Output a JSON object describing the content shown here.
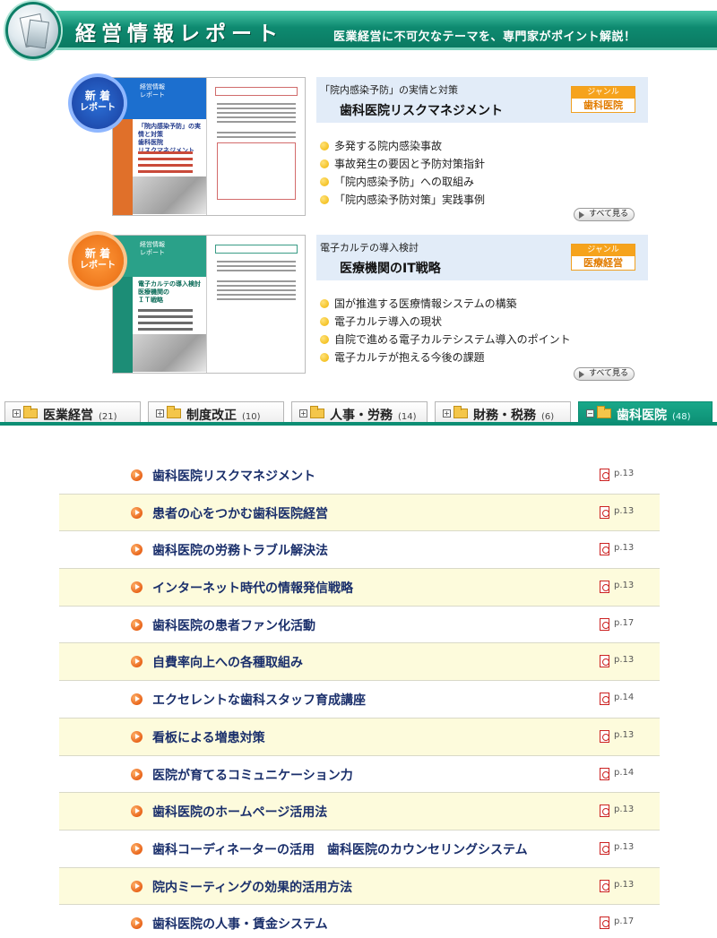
{
  "header": {
    "title": "経営情報レポート",
    "tagline": "医業経営に不可欠なテーマを、専門家がポイント解説！"
  },
  "features": [
    {
      "badge_line1": "新 着",
      "badge_line2": "レポート",
      "cover_brand": "経営情報\nレポート",
      "cover_title": "「院内感染予防」の実情と対策\n歯科医院\nリスクマネジメント",
      "subtitle": "「院内感染予防」の実情と対策",
      "title": "歯科医院リスクマネジメント",
      "genre_label": "ジャンル",
      "genre": "歯科医院",
      "bullets": [
        "多発する院内感染事故",
        "事故発生の要因と予防対策指針",
        "「院内感染予防」への取組み",
        "「院内感染予防対策」実践事例"
      ],
      "see_all": "すべて見る"
    },
    {
      "badge_line1": "新 着",
      "badge_line2": "レポート",
      "cover_brand": "経営情報\nレポート",
      "cover_title": "電子カルテの導入検討\n医療機関の\nＩＴ戦略",
      "subtitle": "電子カルテの導入検討",
      "title": "医療機関のIT戦略",
      "genre_label": "ジャンル",
      "genre": "医療経営",
      "bullets": [
        "国が推進する医療情報システムの構築",
        "電子カルテ導入の現状",
        "自院で進める電子カルテシステム導入のポイント",
        "電子カルテが抱える今後の課題"
      ],
      "see_all": "すべて見る"
    }
  ],
  "tabs": [
    {
      "label": "医業経営",
      "count": "(21)",
      "active": false
    },
    {
      "label": "制度改正",
      "count": "(10)",
      "active": false
    },
    {
      "label": "人事・労務",
      "count": "(14)",
      "active": false
    },
    {
      "label": "財務・税務",
      "count": "(6)",
      "active": false
    },
    {
      "label": "歯科医院",
      "count": "(48)",
      "active": true
    }
  ],
  "articles": [
    {
      "title": "歯科医院リスクマネジメント",
      "page": "p.13"
    },
    {
      "title": "患者の心をつかむ歯科医院経営",
      "page": "p.13"
    },
    {
      "title": "歯科医院の労務トラブル解決法",
      "page": "p.13"
    },
    {
      "title": "インターネット時代の情報発信戦略",
      "page": "p.13"
    },
    {
      "title": "歯科医院の患者ファン化活動",
      "page": "p.17"
    },
    {
      "title": "自費率向上への各種取組み",
      "page": "p.13"
    },
    {
      "title": "エクセレントな歯科スタッフ育成講座",
      "page": "p.14"
    },
    {
      "title": "看板による増患対策",
      "page": "p.13"
    },
    {
      "title": "医院が育てるコミュニケーション力",
      "page": "p.14"
    },
    {
      "title": "歯科医院のホームページ活用法",
      "page": "p.13"
    },
    {
      "title": "歯科コーディネーターの活用　歯科医院のカウンセリングシステム",
      "page": "p.13"
    },
    {
      "title": "院内ミーティングの効果的活用方法",
      "page": "p.13"
    },
    {
      "title": "歯科医院の人事・賃金システム",
      "page": "p.17"
    }
  ],
  "colors": {
    "brand_green": "#0c8e74",
    "row_highlight": "#fdfbdc",
    "title_navy": "#1a2f6b",
    "accent_orange": "#e8641a"
  }
}
